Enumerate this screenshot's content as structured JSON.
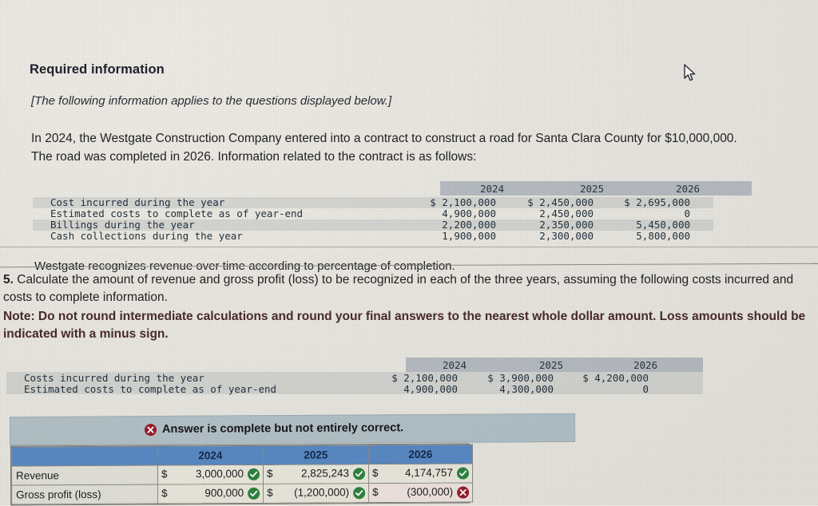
{
  "required_info": {
    "title": "Required information",
    "subtitle": "[The following information applies to the questions displayed below.]",
    "body": "In 2024, the Westgate Construction Company entered into a contract to construct a road for Santa Clara County for $10,000,000. The road was completed in 2026. Information related to the contract is as follows:",
    "footer": "Westgate recognizes revenue over time according to percentage of completion."
  },
  "contract_table": {
    "years": [
      "2024",
      "2025",
      "2026"
    ],
    "rows": [
      {
        "label": "Cost incurred during the year",
        "values": [
          "$ 2,100,000",
          "$ 2,450,000",
          "$ 2,695,000"
        ]
      },
      {
        "label": "Estimated costs to complete as of year-end",
        "values": [
          "4,900,000",
          "2,450,000",
          "0"
        ]
      },
      {
        "label": "Billings during the year",
        "values": [
          "2,200,000",
          "2,350,000",
          "5,450,000"
        ]
      },
      {
        "label": "Cash collections during the year",
        "values": [
          "1,900,000",
          "2,300,000",
          "5,800,000"
        ]
      }
    ]
  },
  "question": {
    "number": "5.",
    "text": " Calculate the amount of revenue and gross profit (loss) to be recognized in each of the three years, assuming the following costs incurred and costs to complete information.",
    "note": "Note: Do not round intermediate calculations and round your final answers to the nearest whole dollar amount. Loss amounts should be indicated with a minus sign."
  },
  "cost_table": {
    "years": [
      "2024",
      "2025",
      "2026"
    ],
    "rows": [
      {
        "label": "Costs incurred during the year",
        "values": [
          "$ 2,100,000",
          "$ 3,900,000",
          "$ 4,200,000"
        ]
      },
      {
        "label": "Estimated costs to complete as of year-end",
        "values": [
          "4,900,000",
          "4,300,000",
          "0"
        ]
      }
    ]
  },
  "answer_banner": {
    "icon": "error-x-icon",
    "text": "Answer is complete but not entirely correct."
  },
  "answer_table": {
    "corner_label": "",
    "columns": [
      "2024",
      "2025",
      "2026"
    ],
    "rows": [
      {
        "label": "Revenue",
        "cells": [
          {
            "currency": "$",
            "value": "3,000,000",
            "status": "correct"
          },
          {
            "currency": "$",
            "value": "2,825,243",
            "status": "correct"
          },
          {
            "currency": "$",
            "value": "4,174,757",
            "status": "correct"
          }
        ]
      },
      {
        "label": "Gross profit (loss)",
        "cells": [
          {
            "currency": "$",
            "value": "900,000",
            "status": "correct"
          },
          {
            "currency": "$",
            "value": "(1,200,000)",
            "status": "correct"
          },
          {
            "currency": "$",
            "value": "(300,000)",
            "status": "incorrect"
          }
        ]
      }
    ]
  },
  "colors": {
    "page_background": "#eceae3",
    "banner_background": "#b6c5cb",
    "table_header_blue": "#5b8cc8",
    "correct_green": "#2e8540",
    "incorrect_red": "#9d1c2b",
    "mono_text": "#23323f"
  },
  "cursor": {
    "icon": "mouse-pointer-icon"
  }
}
